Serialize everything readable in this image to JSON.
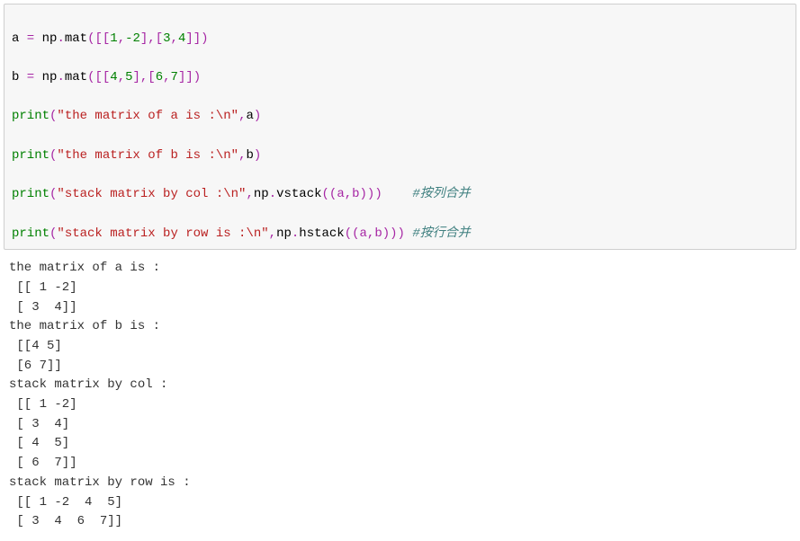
{
  "code": {
    "l1": {
      "a": "a",
      "eq": " = ",
      "np": "np",
      "dot1": ".",
      "mat": "mat",
      "open": "([[",
      "n1": "1",
      "c1": ",",
      "n2": "-2",
      "mid": "],[",
      "n3": "3",
      "c2": ",",
      "n4": "4",
      "close": "]])"
    },
    "l2": {
      "b": "b",
      "eq": " = ",
      "np": "np",
      "dot1": ".",
      "mat": "mat",
      "open": "([[",
      "n1": "4",
      "c1": ",",
      "n2": "5",
      "mid": "],[",
      "n3": "6",
      "c2": ",",
      "n4": "7",
      "close": "]])"
    },
    "l3": {
      "pr": "print",
      "open": "(",
      "str": "\"the matrix of a is :\\n\"",
      "c": ",",
      "arg": "a",
      "close": ")"
    },
    "l4": {
      "pr": "print",
      "open": "(",
      "str": "\"the matrix of b is :\\n\"",
      "c": ",",
      "arg": "b",
      "close": ")"
    },
    "l5": {
      "pr": "print",
      "open": "(",
      "str": "\"stack matrix by col :\\n\"",
      "c": ",",
      "np": "np",
      "dot": ".",
      "fn": "vstack",
      "args": "((a,b))",
      "close": ")",
      "pad": "    ",
      "cmt": "#按列合并"
    },
    "l6": {
      "pr": "print",
      "open": "(",
      "str": "\"stack matrix by row is :\\n\"",
      "c": ",",
      "np": "np",
      "dot": ".",
      "fn": "hstack",
      "args": "((a,b))",
      "close": ")",
      "pad": " ",
      "cmt": "#按行合并"
    }
  },
  "output": {
    "line1": "the matrix of a is :",
    "line2": " [[ 1 -2]",
    "line3": " [ 3  4]]",
    "line4": "the matrix of b is :",
    "line5": " [[4 5]",
    "line6": " [6 7]]",
    "line7": "stack matrix by col :",
    "line8": " [[ 1 -2]",
    "line9": " [ 3  4]",
    "line10": " [ 4  5]",
    "line11": " [ 6  7]]",
    "line12": "stack matrix by row is :",
    "line13": " [[ 1 -2  4  5]",
    "line14": " [ 3  4  6  7]]"
  }
}
